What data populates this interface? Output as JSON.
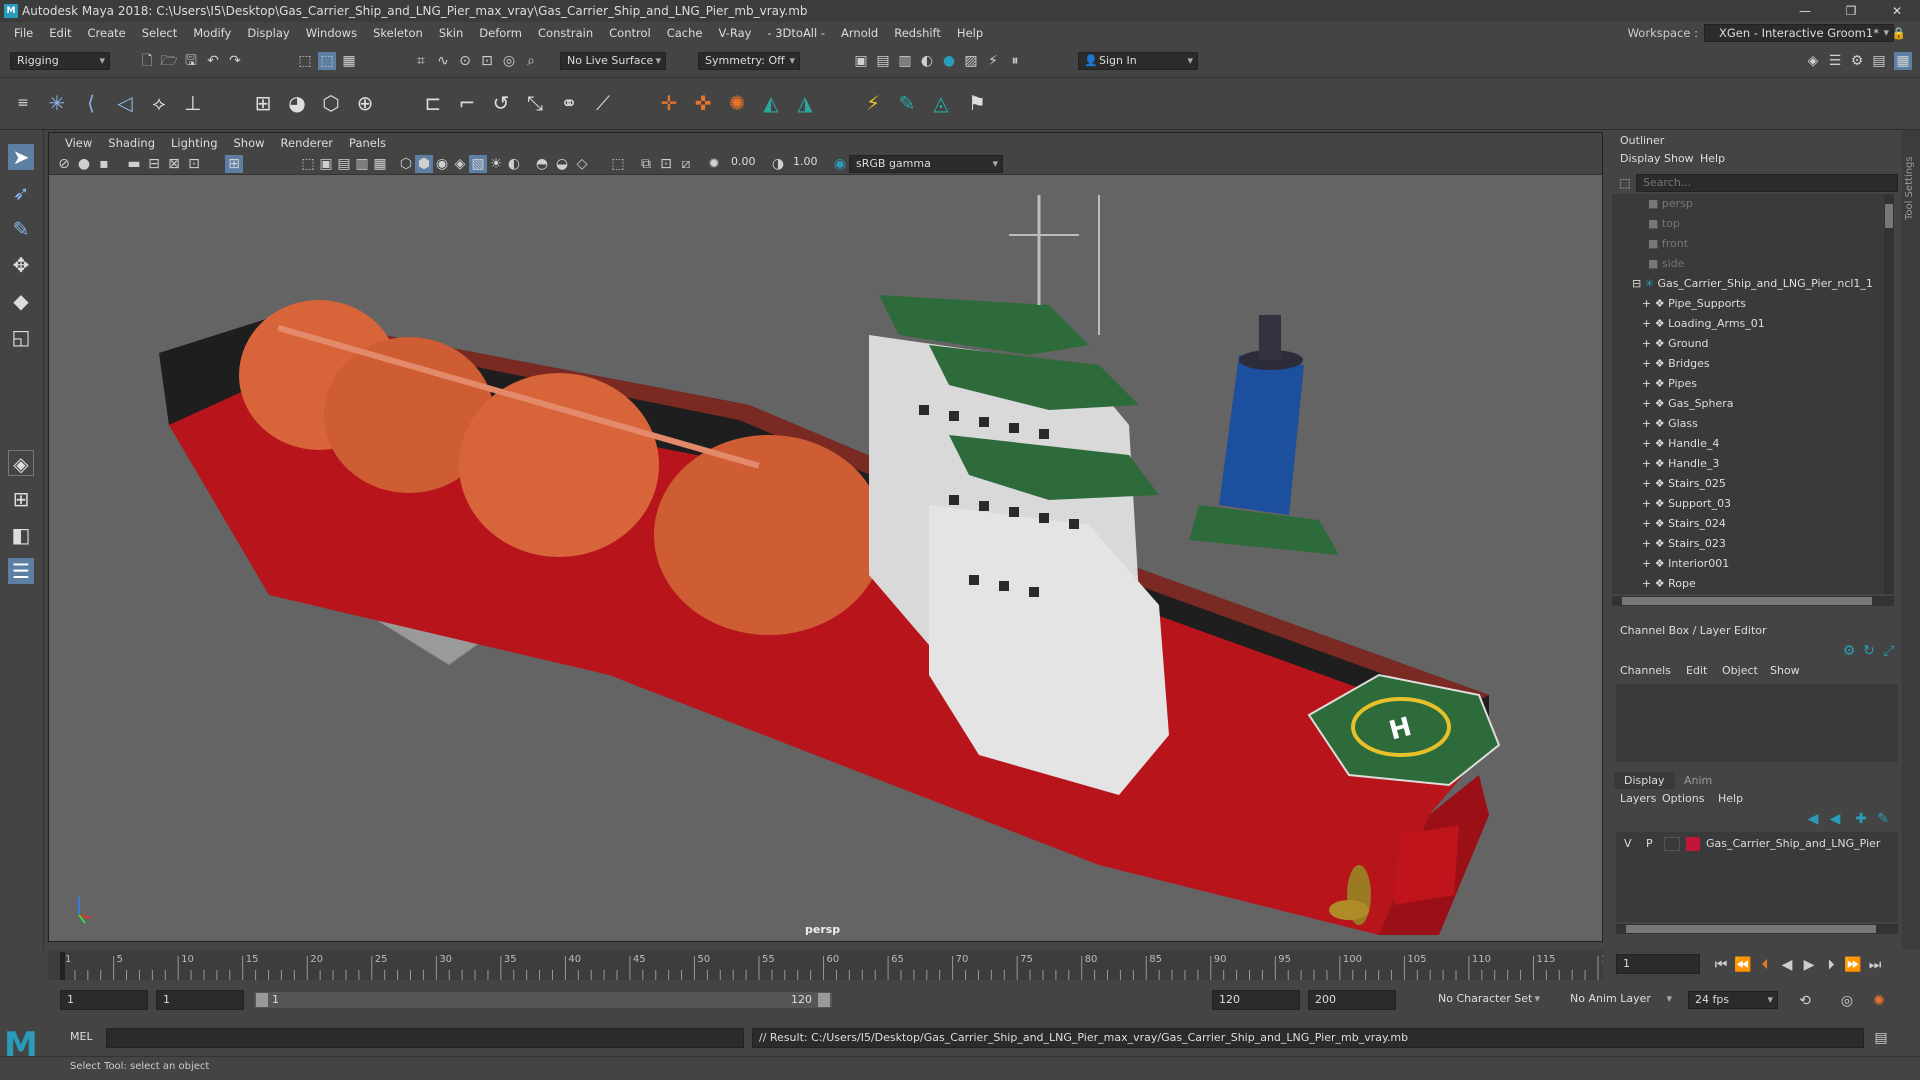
{
  "window": {
    "title": "Autodesk Maya 2018: C:\\Users\\I5\\Desktop\\Gas_Carrier_Ship_and_LNG_Pier_max_vray\\Gas_Carrier_Ship_and_LNG_Pier_mb_vray.mb",
    "logo": "M"
  },
  "menubar": {
    "items": [
      "File",
      "Edit",
      "Create",
      "Select",
      "Modify",
      "Display",
      "Windows",
      "Skeleton",
      "Skin",
      "Deform",
      "Constrain",
      "Control",
      "Cache",
      "V-Ray",
      "- 3DtoAll -",
      "Arnold",
      "Redshift",
      "Help"
    ],
    "workspace_label": "Workspace :",
    "workspace_value": "XGen - Interactive Groom1*"
  },
  "statusline": {
    "mode": "Rigging",
    "live_surface": "No Live Surface",
    "symmetry": "Symmetry: Off",
    "sign_in": "Sign In"
  },
  "viewport": {
    "menu": [
      "View",
      "Shading",
      "Lighting",
      "Show",
      "Renderer",
      "Panels"
    ],
    "exposure": "0.00",
    "gamma": "1.00",
    "color_space": "sRGB gamma",
    "camera_label": "persp"
  },
  "outliner": {
    "title": "Outliner",
    "menu": [
      "Display",
      "Show",
      "Help"
    ],
    "search_placeholder": "Search...",
    "cameras": [
      "persp",
      "top",
      "front",
      "side"
    ],
    "root": "Gas_Carrier_Ship_and_LNG_Pier_ncl1_1",
    "children": [
      "Pipe_Supports",
      "Loading_Arms_01",
      "Ground",
      "Bridges",
      "Pipes",
      "Gas_Sphera",
      "Glass",
      "Handle_4",
      "Handle_3",
      "Stairs_025",
      "Support_03",
      "Stairs_024",
      "Stairs_023",
      "Interior001",
      "Rope"
    ]
  },
  "channelbox": {
    "title": "Channel Box / Layer Editor",
    "menu": [
      "Channels",
      "Edit",
      "Object",
      "Show"
    ]
  },
  "layer_editor": {
    "tabs": [
      "Display",
      "Anim"
    ],
    "menu": [
      "Layers",
      "Options",
      "Help"
    ],
    "layer": {
      "v": "V",
      "p": "P",
      "name": "Gas_Carrier_Ship_and_LNG_Pier",
      "color": "#c0163a"
    }
  },
  "timeline": {
    "ticks": [
      "1",
      "5",
      "10",
      "15",
      "20",
      "25",
      "30",
      "35",
      "40",
      "45",
      "50",
      "55",
      "60",
      "65",
      "70",
      "75",
      "80",
      "85",
      "90",
      "95",
      "100",
      "105",
      "110",
      "115",
      "120"
    ],
    "current_frame": "1"
  },
  "range": {
    "start": "1",
    "playback_start": "1",
    "slider_start": "1",
    "slider_end": "120",
    "playback_end": "120",
    "end": "200",
    "character_set": "No Character Set",
    "anim_layer": "No Anim Layer",
    "fps": "24 fps"
  },
  "cmdline": {
    "lang": "MEL",
    "result": "// Result: C:/Users/I5/Desktop/Gas_Carrier_Ship_and_LNG_Pier_max_vray/Gas_Carrier_Ship_and_LNG_Pier_mb_vray.mb"
  },
  "helpline": {
    "text": "Select Tool: select an object"
  },
  "colors": {
    "hull_red": "#c0141c",
    "tank_orange": "#d8643a",
    "deck_green": "#2e6b3a",
    "funnel_blue": "#1c4f9e",
    "accent_cyan": "#2a9bb8"
  }
}
